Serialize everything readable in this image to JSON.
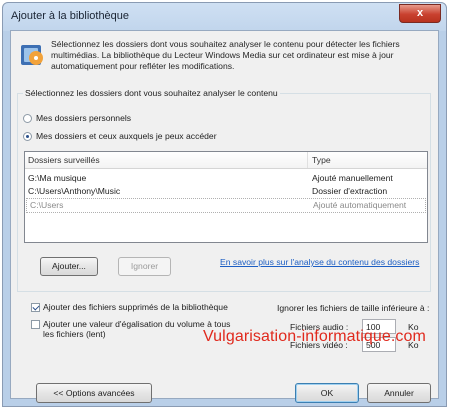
{
  "window": {
    "title": "Ajouter à la bibliothèque",
    "close_glyph": "x"
  },
  "intro": "Sélectionnez les dossiers dont vous souhaitez analyser le contenu pour détecter les fichiers multimédias. La bibliothèque du Lecteur Windows Media sur cet ordinateur est mise à jour automatiquement pour refléter les modifications.",
  "group": {
    "label": "Sélectionnez les dossiers dont vous souhaitez analyser le contenu",
    "radio_personal": "Mes dossiers personnels",
    "radio_all": "Mes dossiers et ceux auxquels je peux accéder",
    "selected": "radio_all"
  },
  "list": {
    "headers": [
      "Dossiers surveillés",
      "Type"
    ],
    "rows": [
      {
        "folder": "G:\\Ma musique",
        "type": "Ajouté manuellement"
      },
      {
        "folder": "C:\\Users\\Anthony\\Music",
        "type": "Dossier d'extraction"
      },
      {
        "folder": "C:\\Users",
        "type": "Ajouté automatiquement"
      }
    ]
  },
  "buttons": {
    "add": "Ajouter...",
    "ignore": "Ignorer",
    "advanced": "<< Options avancées",
    "ok": "OK",
    "cancel": "Annuler"
  },
  "link": "En savoir plus sur l'analyse du contenu des dossiers",
  "options": {
    "add_deleted": "Ajouter des fichiers supprimés de la bibliothèque",
    "add_deleted_checked": true,
    "volume_eq": "Ajouter une valeur d'égalisation du volume à tous les fichiers (lent)",
    "volume_eq_checked": false,
    "ignore_smaller": "Ignorer les fichiers de taille inférieure à :",
    "audio_label": "Fichiers audio :",
    "audio_value": "100",
    "video_label": "Fichiers vidéo :",
    "video_value": "500",
    "unit": "Ko"
  },
  "watermark": "Vulgarisation-informatique.com",
  "colors": {
    "accent": "#1c5ec4",
    "watermark": "#e0291d",
    "close": "#c9412f"
  }
}
